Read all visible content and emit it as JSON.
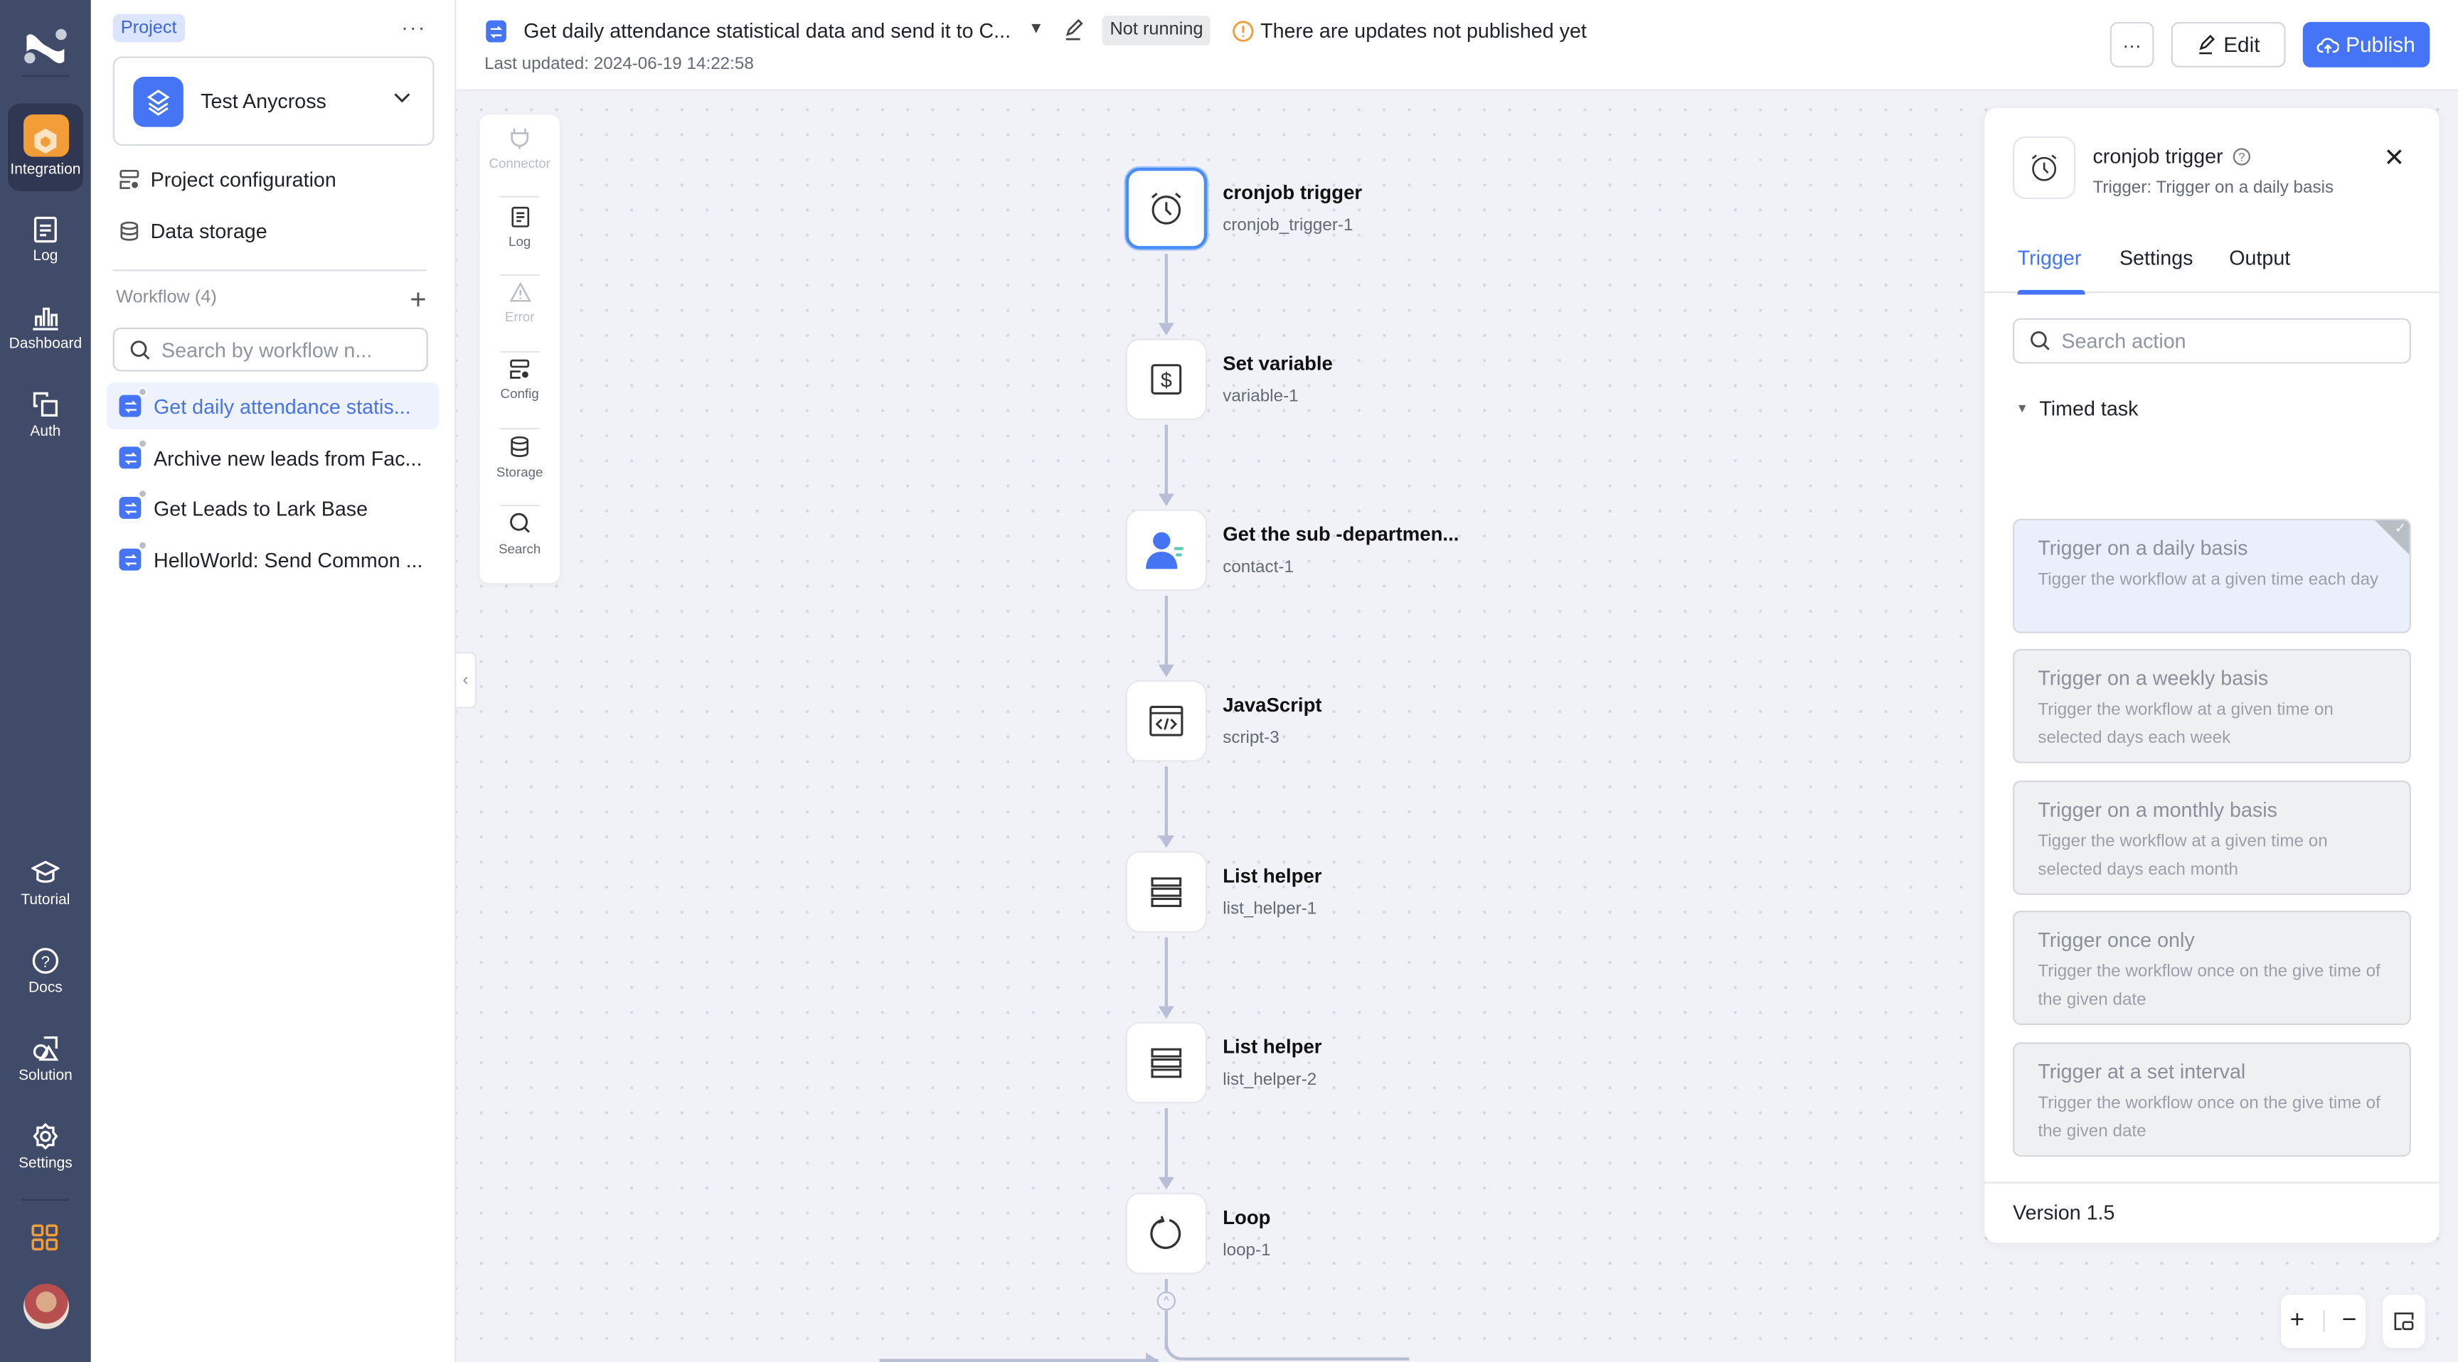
{
  "rail": {
    "items": [
      {
        "label": "Integration",
        "icon": "integration-icon",
        "active": true
      },
      {
        "label": "Log",
        "icon": "log-icon"
      },
      {
        "label": "Dashboard",
        "icon": "dashboard-icon"
      },
      {
        "label": "Auth",
        "icon": "auth-icon"
      },
      {
        "label": "Tutorial",
        "icon": "tutorial-icon"
      },
      {
        "label": "Docs",
        "icon": "docs-icon"
      },
      {
        "label": "Solution",
        "icon": "solution-icon"
      },
      {
        "label": "Settings",
        "icon": "settings-icon"
      }
    ],
    "apps_icon": "apps-grid-icon",
    "accent": "#f29d38"
  },
  "project": {
    "tag": "Project",
    "more": "···",
    "name": "Test Anycross",
    "menu": [
      {
        "label": "Project configuration",
        "icon": "config-icon"
      },
      {
        "label": "Data storage",
        "icon": "database-icon"
      }
    ],
    "workflow_header": "Workflow (4)",
    "search_placeholder": "Search by workflow n...",
    "workflows": [
      {
        "label": "Get daily attendance statis...",
        "active": true
      },
      {
        "label": "Archive new leads from Fac..."
      },
      {
        "label": "Get Leads to Lark Base"
      },
      {
        "label": "HelloWorld: Send Common ..."
      }
    ]
  },
  "topbar": {
    "title": "Get daily attendance statistical data and send it to C...",
    "caret": "▼",
    "status": "Not running",
    "warning": "There are updates not published yet",
    "last_updated": "Last updated: 2024-06-19 14:22:58",
    "more": "···",
    "edit": "Edit",
    "publish": "Publish",
    "brand_color": "#4674f6"
  },
  "toolbox": [
    {
      "label": "Connector",
      "icon": "plug-icon",
      "disabled": true
    },
    {
      "label": "Log",
      "icon": "log-icon"
    },
    {
      "label": "Error",
      "icon": "warning-icon",
      "disabled": true
    },
    {
      "label": "Config",
      "icon": "config-icon"
    },
    {
      "label": "Storage",
      "icon": "database-icon"
    },
    {
      "label": "Search",
      "icon": "search-icon"
    }
  ],
  "nodes": [
    {
      "title": "cronjob trigger",
      "id": "cronjob_trigger-1",
      "icon": "alarm-clock-icon",
      "selected": true
    },
    {
      "title": "Set variable",
      "id": "variable-1",
      "icon": "dollar-box-icon"
    },
    {
      "title": "Get the sub -departmen...",
      "id": "contact-1",
      "icon": "contact-icon"
    },
    {
      "title": "JavaScript",
      "id": "script-3",
      "icon": "code-icon"
    },
    {
      "title": "List helper",
      "id": "list_helper-1",
      "icon": "list-icon"
    },
    {
      "title": "List helper",
      "id": "list_helper-2",
      "icon": "list-icon"
    },
    {
      "title": "Loop",
      "id": "loop-1",
      "icon": "loop-icon"
    }
  ],
  "inspector": {
    "title": "cronjob trigger",
    "subtitle": "Trigger: Trigger on a daily basis",
    "close": "✕",
    "tabs": [
      "Trigger",
      "Settings",
      "Output"
    ],
    "active_tab": "Trigger",
    "search_placeholder": "Search action",
    "group": "Timed task",
    "cards": [
      {
        "title": "Trigger on a daily basis",
        "desc": "Tigger the workflow at a given time each day",
        "selected": true
      },
      {
        "title": "Trigger on a weekly basis",
        "desc": "Trigger the workflow at a given time on selected days each week"
      },
      {
        "title": "Trigger on a monthly basis",
        "desc": "Tigger the workflow at a given time on selected days each month"
      },
      {
        "title": "Trigger once only",
        "desc": "Trigger the workflow once on the give time of the given date"
      },
      {
        "title": "Trigger at a set interval",
        "desc": "Trigger the workflow once on the give time of the given date"
      }
    ],
    "version": "Version 1.5"
  },
  "zoom_controls": {
    "plus": "+",
    "minus": "−"
  }
}
